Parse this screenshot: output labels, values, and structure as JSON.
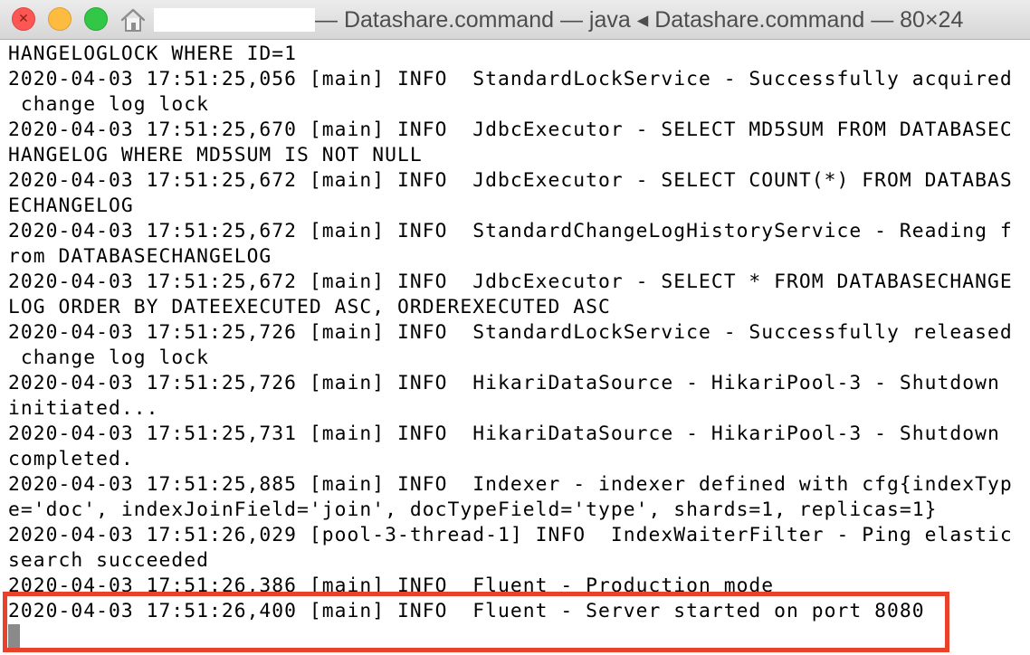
{
  "window": {
    "title": "— Datashare.command — java ◂ Datashare.command — 80×24",
    "close_glyph": "✕",
    "colors": {
      "close": "#fc5753",
      "minimize": "#fdbc40",
      "zoom": "#33c748",
      "highlight": "#e8412c"
    }
  },
  "terminal": {
    "lines": [
      "HANGELOGLOCK WHERE ID=1",
      "2020-04-03 17:51:25,056 [main] INFO  StandardLockService - Successfully acquired",
      " change log lock",
      "2020-04-03 17:51:25,670 [main] INFO  JdbcExecutor - SELECT MD5SUM FROM DATABASEC",
      "HANGELOG WHERE MD5SUM IS NOT NULL",
      "2020-04-03 17:51:25,672 [main] INFO  JdbcExecutor - SELECT COUNT(*) FROM DATABAS",
      "ECHANGELOG",
      "2020-04-03 17:51:25,672 [main] INFO  StandardChangeLogHistoryService - Reading f",
      "rom DATABASECHANGELOG",
      "2020-04-03 17:51:25,672 [main] INFO  JdbcExecutor - SELECT * FROM DATABASECHANGE",
      "LOG ORDER BY DATEEXECUTED ASC, ORDEREXECUTED ASC",
      "2020-04-03 17:51:25,726 [main] INFO  StandardLockService - Successfully released",
      " change log lock",
      "2020-04-03 17:51:25,726 [main] INFO  HikariDataSource - HikariPool-3 - Shutdown",
      "initiated...",
      "2020-04-03 17:51:25,731 [main] INFO  HikariDataSource - HikariPool-3 - Shutdown",
      "completed.",
      "2020-04-03 17:51:25,885 [main] INFO  Indexer - indexer defined with cfg{indexTyp",
      "e='doc', indexJoinField='join', docTypeField='type', shards=1, replicas=1}",
      "2020-04-03 17:51:26,029 [pool-3-thread-1] INFO  IndexWaiterFilter - Ping elastic",
      "search succeeded",
      "2020-04-03 17:51:26,386 [main] INFO  Fluent - Production mode",
      "2020-04-03 17:51:26,400 [main] INFO  Fluent - Server started on port 8080"
    ]
  }
}
